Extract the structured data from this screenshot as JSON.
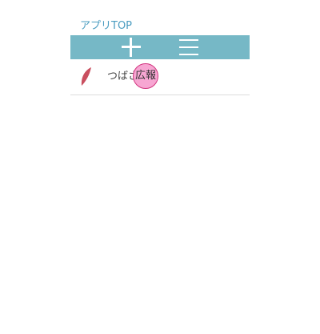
{
  "header": {
    "top_link": "アプリTOP"
  },
  "toolbar": {
    "add_icon": "plus-icon",
    "menu_icon": "hamburger-menu-icon",
    "background": "#76b8c6"
  },
  "list": {
    "items": [
      {
        "label": "つばさ",
        "badge": "広報",
        "icon": "feather-icon",
        "icon_color": "#c94f5f"
      }
    ]
  },
  "colors": {
    "link": "#4a9cc0",
    "badge_fill": "#f7a6d2",
    "badge_border": "#d2357f"
  }
}
